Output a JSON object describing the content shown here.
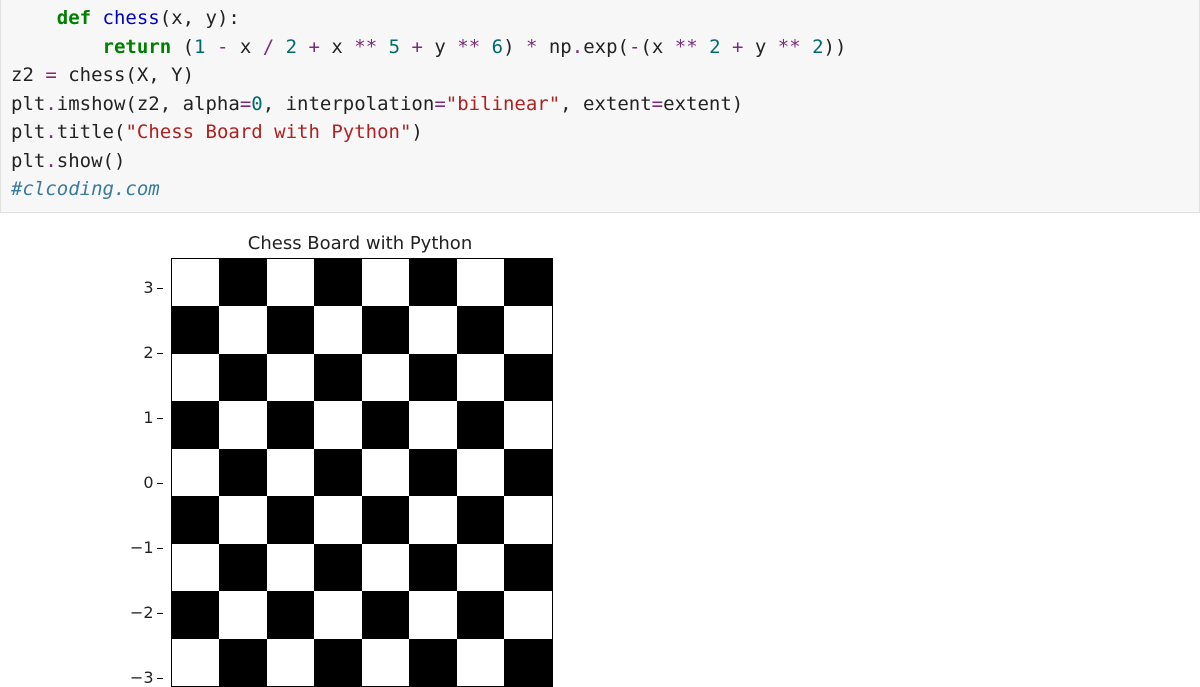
{
  "code": {
    "line1_kw": "def",
    "line1_fn": "chess",
    "line1_rest": "(x, y):",
    "line2_kw": "return",
    "line2_rest1": " (",
    "line2_n1": "1",
    "line2_op1": " - ",
    "line2_x1": "x ",
    "line2_op2": "/ ",
    "line2_n2": "2",
    "line2_op3": " + ",
    "line2_x2": "x ",
    "line2_op4": "** ",
    "line2_n5": "5",
    "line2_op5": " + ",
    "line2_y1": "y ",
    "line2_op6": "** ",
    "line2_n6": "6",
    "line2_rest2": ") ",
    "line2_op7": "* ",
    "line2_np": "np",
    "line2_dot": ".",
    "line2_exp": "exp",
    "line2_rest3": "(",
    "line2_op8": "-",
    "line2_rest4": "(x ",
    "line2_op9": "** ",
    "line2_n2b": "2",
    "line2_op10": " + ",
    "line2_y2": "y ",
    "line2_op11": "** ",
    "line2_n2c": "2",
    "line2_rest5": "))",
    "line3_a": "z2 ",
    "line3_op": "= ",
    "line3_b": "chess(X, Y)",
    "line4_a": "plt",
    "line4_dot": ".",
    "line4_fn": "imshow",
    "line4_b": "(z2, alpha",
    "line4_op": "=",
    "line4_n": "0",
    "line4_c": ", interpolation",
    "line4_op2": "=",
    "line4_str": "\"bilinear\"",
    "line4_d": ", extent",
    "line4_op3": "=",
    "line4_e": "extent)",
    "line5_a": "plt",
    "line5_dot": ".",
    "line5_fn": "title",
    "line5_b": "(",
    "line5_str": "\"Chess Board with Python\"",
    "line5_c": ")",
    "line6_a": "plt",
    "line6_dot": ".",
    "line6_fn": "show",
    "line6_b": "()",
    "line7": "#clcoding.com"
  },
  "chart_data": {
    "type": "heatmap",
    "title": "Chess Board with Python",
    "pattern": "8x8 alternating checkerboard, black and white",
    "y_ticks": [
      "3",
      "2",
      "1",
      "0",
      "−1",
      "−2",
      "−3"
    ],
    "ylim": [
      -3.5,
      3.5
    ]
  }
}
